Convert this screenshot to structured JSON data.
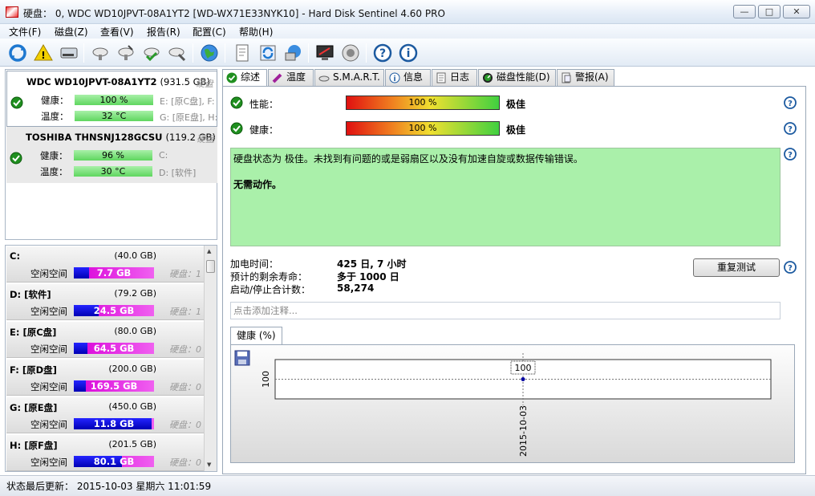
{
  "window": {
    "title": "硬盘： 0, WDC WD10JPVT-08A1YT2 [WD-WX71E33NYK10]  -  Hard Disk Sentinel 4.60 PRO",
    "minimize": "—",
    "maximize": "□",
    "close": "✕"
  },
  "menu": [
    "文件(F)",
    "磁盘(Z)",
    "查看(V)",
    "报告(R)",
    "配置(C)",
    "帮助(H)"
  ],
  "toolbar_icons": [
    "refresh-icon",
    "alert-icon",
    "disk-icon",
    "disk-tool-icon",
    "disk-test-icon",
    "disk-check-icon",
    "disk-repair-icon",
    "globe-icon",
    "report-icon",
    "sync-icon",
    "network-icon",
    "monitor-icon",
    "speaker-icon",
    "help-icon",
    "info-icon"
  ],
  "disks": [
    {
      "name": "WDC WD10JPVT-08A1YT2",
      "size": "(931.5 GB)",
      "type": "硬盘",
      "health_label": "健康：",
      "health": "100 %",
      "temp_label": "温度：",
      "temp": "32 °C",
      "drives1": "E: [原C盘], F: [原D盘]",
      "drives2": "G: [原E盘], H: [原F盘]"
    },
    {
      "name": "TOSHIBA THNSNJ128GCSU",
      "size": "(119.2 GB)",
      "type": "硬盘",
      "health_label": "健康：",
      "health": "96 %",
      "temp_label": "温度：",
      "temp": "30 °C",
      "drives1": "C:",
      "drives2": "D: [软件]"
    }
  ],
  "volumes": [
    {
      "name": "C:",
      "size": "(40.0 GB)",
      "free_label": "空闲空间",
      "free": "7.7 GB",
      "free_fraction": 0.19,
      "disk": "硬盘：1"
    },
    {
      "name": "D: [软件]",
      "size": "(79.2 GB)",
      "free_label": "空闲空间",
      "free": "24.5 GB",
      "free_fraction": 0.31,
      "disk": "硬盘：1"
    },
    {
      "name": "E: [原C盘]",
      "size": "(80.0 GB)",
      "free_label": "空闲空间",
      "free": "64.5 GB",
      "free_fraction": 0.17,
      "disk": "硬盘：0"
    },
    {
      "name": "F: [原D盘]",
      "size": "(200.0 GB)",
      "free_label": "空闲空间",
      "free": "169.5 GB",
      "free_fraction": 0.15,
      "disk": "硬盘：0"
    },
    {
      "name": "G: [原E盘]",
      "size": "(450.0 GB)",
      "free_label": "空闲空间",
      "free": "11.8 GB",
      "free_fraction": 0.97,
      "disk": "硬盘：0"
    },
    {
      "name": "H: [原F盘]",
      "size": "(201.5 GB)",
      "free_label": "空闲空间",
      "free": "80.1 GB",
      "free_fraction": 0.6,
      "disk": "硬盘：0"
    }
  ],
  "tabs": [
    "综述",
    "温度",
    "S.M.A.R.T.",
    "信息",
    "日志",
    "磁盘性能(D)",
    "警报(A)"
  ],
  "overview": {
    "performance_label": "性能：",
    "performance": "100 %",
    "performance_rating": "极佳",
    "health_label": "健康：",
    "health": "100 %",
    "health_rating": "极佳",
    "status_text": "硬盘状态为 极佳。未找到有问题的或是弱扇区以及没有加速自旋或数据传输错误。",
    "status_action": "无需动作。",
    "power_on_label": "加电时间：",
    "power_on": "425 日, 7 小时",
    "lifetime_label": "预计的剩余寿命：",
    "lifetime": "多于 1000 日",
    "startstop_label": "启动/停止合计数：",
    "startstop": "58,274",
    "retest_button": "重复测试",
    "note_placeholder": "点击添加注释..."
  },
  "chart_data": {
    "type": "line",
    "title": "",
    "tab_label": "健康 (%)",
    "x": [
      "2015-10-03"
    ],
    "series": [
      {
        "values": [
          100
        ]
      }
    ],
    "data_labels": [
      "100"
    ],
    "ylabel": "",
    "y_tick_labels": [
      "100"
    ],
    "x_tick_labels": [
      "2015-10-03"
    ],
    "grid": true
  },
  "statusbar": {
    "text": "状态最后更新： 2015-10-03 星期六 11:01:59"
  }
}
